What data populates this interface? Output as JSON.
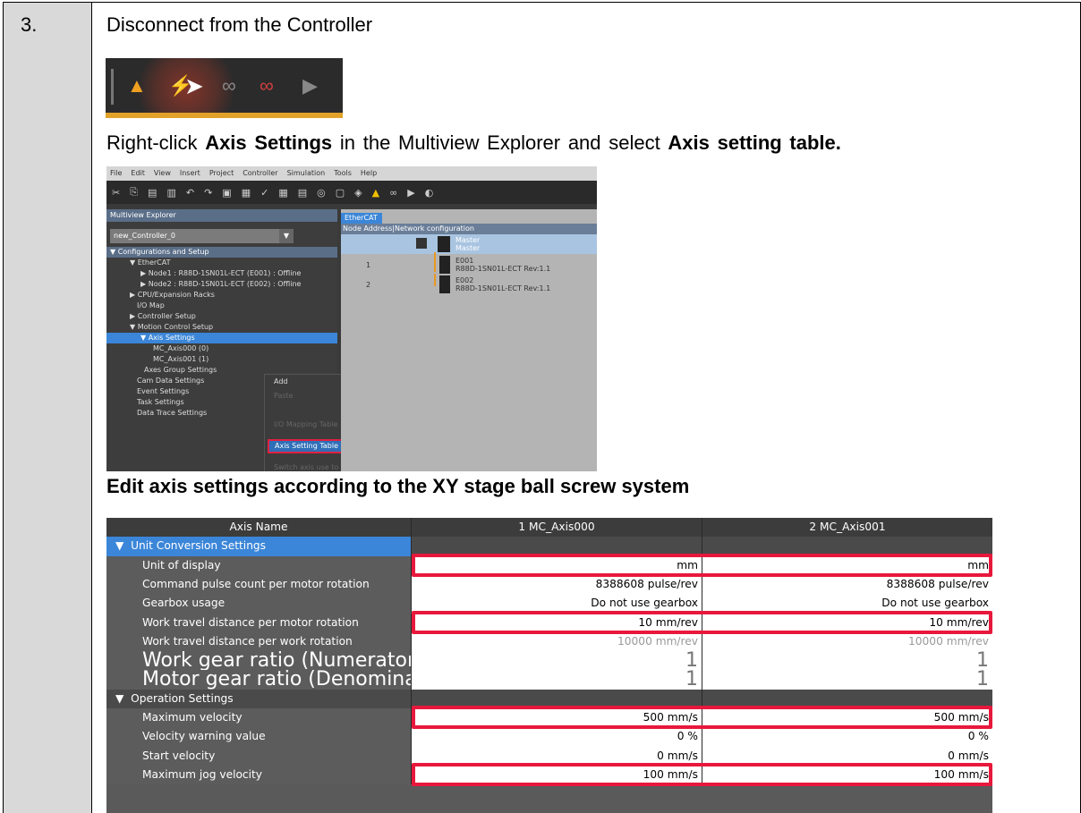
{
  "step": {
    "number": "3.",
    "title": "Disconnect from the Controller",
    "instruction": {
      "pre": "Right-click ",
      "bold1": "Axis Settings",
      "mid": " in the Multiview Explorer and select ",
      "bold2": "Axis setting table."
    },
    "section_title": "Edit axis settings according to the XY stage ball screw system"
  },
  "toolbar_icons": [
    "warning-icon",
    "disconnect-icon",
    "online-icon",
    "offline-icon",
    "transfer-icon"
  ],
  "studio": {
    "menu": [
      "File",
      "Edit",
      "View",
      "Insert",
      "Project",
      "Controller",
      "Simulation",
      "Tools",
      "Help"
    ],
    "explorer_title": "Multiview Explorer",
    "controller_combo": "new_Controller_0",
    "tree": [
      "Configurations and Setup",
      "EtherCAT",
      "Node1 : R88D-1SN01L-ECT (E001) : Offline",
      "Node2 : R88D-1SN01L-ECT (E002) : Offline",
      "CPU/Expansion Racks",
      "I/O Map",
      "Controller Setup",
      "Motion Control Setup",
      "Axis Settings",
      "MC_Axis000 (0)",
      "MC_Axis001 (1)",
      "Axes Group Settings",
      "Cam Data Settings",
      "Event Settings",
      "Task Settings",
      "Data Trace Settings"
    ],
    "context_menu": {
      "items": [
        "Add",
        "Paste",
        "",
        "I/O Mapping Table",
        "Axis Setting Table",
        "Switch axis use to Unused"
      ],
      "highlight": "Axis Setting Table"
    },
    "ethercat": {
      "tab": "EtherCAT",
      "header": "Node Address|Network configuration",
      "master": "Master",
      "nodes": [
        {
          "addr": "1",
          "name": "E001",
          "model": "R88D-1SN01L-ECT Rev:1.1"
        },
        {
          "addr": "2",
          "name": "E002",
          "model": "R88D-1SN01L-ECT Rev:1.1"
        }
      ]
    }
  },
  "axis_table": {
    "headers": [
      "Axis Name",
      "1 MC_Axis000",
      "2 MC_Axis001"
    ],
    "sections": [
      {
        "title": "Unit Conversion Settings",
        "rows": [
          {
            "label": "Unit of display",
            "v1": "mm",
            "v2": "mm"
          },
          {
            "label": "Command pulse count per motor rotation",
            "v1": "8388608 pulse/rev",
            "v2": "8388608 pulse/rev"
          },
          {
            "label": "Gearbox usage",
            "v1": "Do not use gearbox",
            "v2": "Do not use gearbox"
          },
          {
            "label": "Work travel distance per motor rotation",
            "v1": "10 mm/rev",
            "v2": "10 mm/rev"
          },
          {
            "label": "Work travel distance per work rotation",
            "v1": "10000 mm/rev",
            "v2": "10000 mm/rev"
          },
          {
            "label": "Work gear ratio (Numerator of the reduction rati",
            "v1": "1",
            "v2": "1"
          },
          {
            "label": "Motor gear ratio (Denominator of the reduction r",
            "v1": "1",
            "v2": "1"
          }
        ]
      },
      {
        "title": "Operation Settings",
        "rows": [
          {
            "label": "Maximum velocity",
            "v1": "500 mm/s",
            "v2": "500 mm/s"
          },
          {
            "label": "Velocity warning value",
            "v1": "0 %",
            "v2": "0 %"
          },
          {
            "label": "Start velocity",
            "v1": "0 mm/s",
            "v2": "0 mm/s"
          },
          {
            "label": "Maximum jog velocity",
            "v1": "100 mm/s",
            "v2": "100 mm/s"
          }
        ]
      }
    ]
  },
  "colors": {
    "highlight": "#e8183c",
    "selection": "#3b86d8",
    "accent_bar": "#e2a22a"
  }
}
